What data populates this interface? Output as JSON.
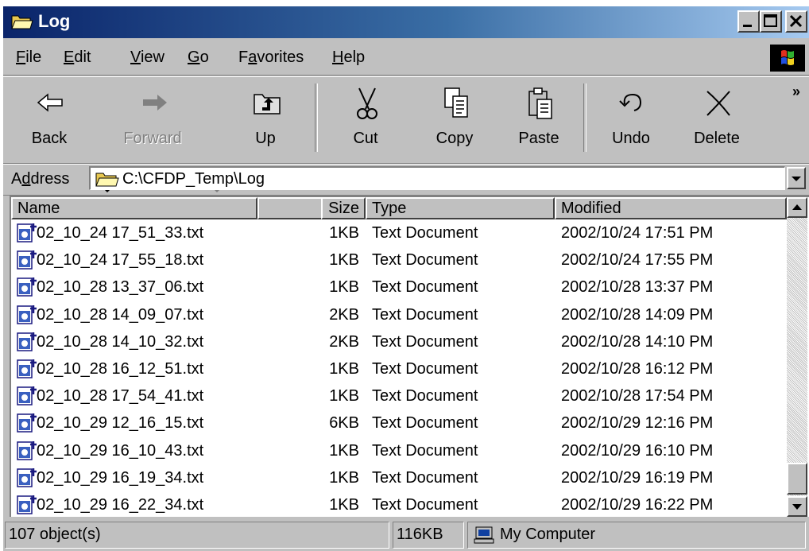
{
  "window": {
    "title": "Log"
  },
  "menu": {
    "items": [
      {
        "label": "File",
        "accel": "F"
      },
      {
        "label": "Edit",
        "accel": "E"
      },
      {
        "label": "View",
        "accel": "V"
      },
      {
        "label": "Go",
        "accel": "G"
      },
      {
        "label": "Favorites",
        "accel": "a"
      },
      {
        "label": "Help",
        "accel": "H"
      }
    ]
  },
  "toolbar": {
    "back": "Back",
    "forward": "Forward",
    "up": "Up",
    "cut": "Cut",
    "copy": "Copy",
    "paste": "Paste",
    "undo": "Undo",
    "delete": "Delete",
    "more": "»"
  },
  "address": {
    "label": "Address",
    "value": "C:\\CFDP_Temp\\Log"
  },
  "columns": {
    "name": "Name",
    "size": "Size",
    "type": "Type",
    "modified": "Modified"
  },
  "files": [
    {
      "name": "02_10_24 17_51_33.txt",
      "size": "1KB",
      "type": "Text Document",
      "modified": "2002/10/24 17:51 PM"
    },
    {
      "name": "02_10_24 17_55_18.txt",
      "size": "1KB",
      "type": "Text Document",
      "modified": "2002/10/24 17:55 PM"
    },
    {
      "name": "02_10_28 13_37_06.txt",
      "size": "1KB",
      "type": "Text Document",
      "modified": "2002/10/28 13:37 PM"
    },
    {
      "name": "02_10_28 14_09_07.txt",
      "size": "2KB",
      "type": "Text Document",
      "modified": "2002/10/28 14:09 PM"
    },
    {
      "name": "02_10_28 14_10_32.txt",
      "size": "2KB",
      "type": "Text Document",
      "modified": "2002/10/28 14:10 PM"
    },
    {
      "name": "02_10_28 16_12_51.txt",
      "size": "1KB",
      "type": "Text Document",
      "modified": "2002/10/28 16:12 PM"
    },
    {
      "name": "02_10_28 17_54_41.txt",
      "size": "1KB",
      "type": "Text Document",
      "modified": "2002/10/28 17:54 PM"
    },
    {
      "name": "02_10_29 12_16_15.txt",
      "size": "6KB",
      "type": "Text Document",
      "modified": "2002/10/29 12:16 PM"
    },
    {
      "name": "02_10_29 16_10_43.txt",
      "size": "1KB",
      "type": "Text Document",
      "modified": "2002/10/29 16:10 PM"
    },
    {
      "name": "02_10_29 16_19_34.txt",
      "size": "1KB",
      "type": "Text Document",
      "modified": "2002/10/29 16:19 PM"
    },
    {
      "name": "02_10_29 16_22_34.txt",
      "size": "1KB",
      "type": "Text Document",
      "modified": "2002/10/29 16:22 PM"
    }
  ],
  "status": {
    "objects": "107 object(s)",
    "total_size": "116KB",
    "zone": "My Computer"
  },
  "icons": {
    "title": "open-folder-icon",
    "file": "text-document-icon",
    "zone": "my-computer-icon",
    "brand": "windows-logo-icon"
  },
  "colors": {
    "title_start": "#0a246a",
    "title_end": "#a6caf0",
    "face": "#c0c0c0",
    "list_bg": "#ffffff"
  }
}
